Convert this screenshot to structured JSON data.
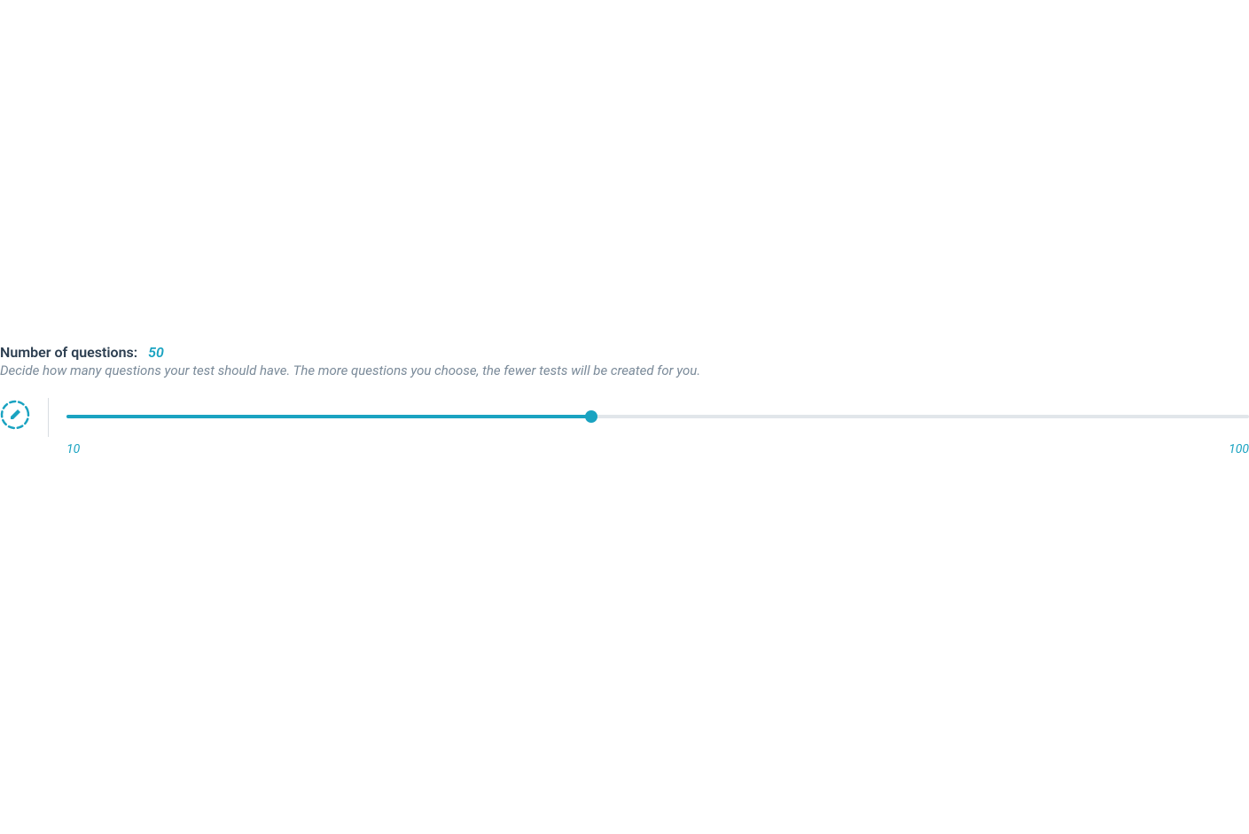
{
  "questions": {
    "title_label": "Number of questions:",
    "current_value": "50",
    "description": "Decide how many questions your test should have. The more questions you choose, the fewer tests will be created for you.",
    "slider": {
      "min_label": "10",
      "max_label": "100",
      "min": 10,
      "max": 100,
      "value": 50,
      "fill_percent": "44.4%"
    }
  },
  "colors": {
    "accent": "#1aa3c1",
    "text_primary": "#2c3e50",
    "text_muted": "#7a8a99",
    "track_bg": "#e1e6ea"
  }
}
